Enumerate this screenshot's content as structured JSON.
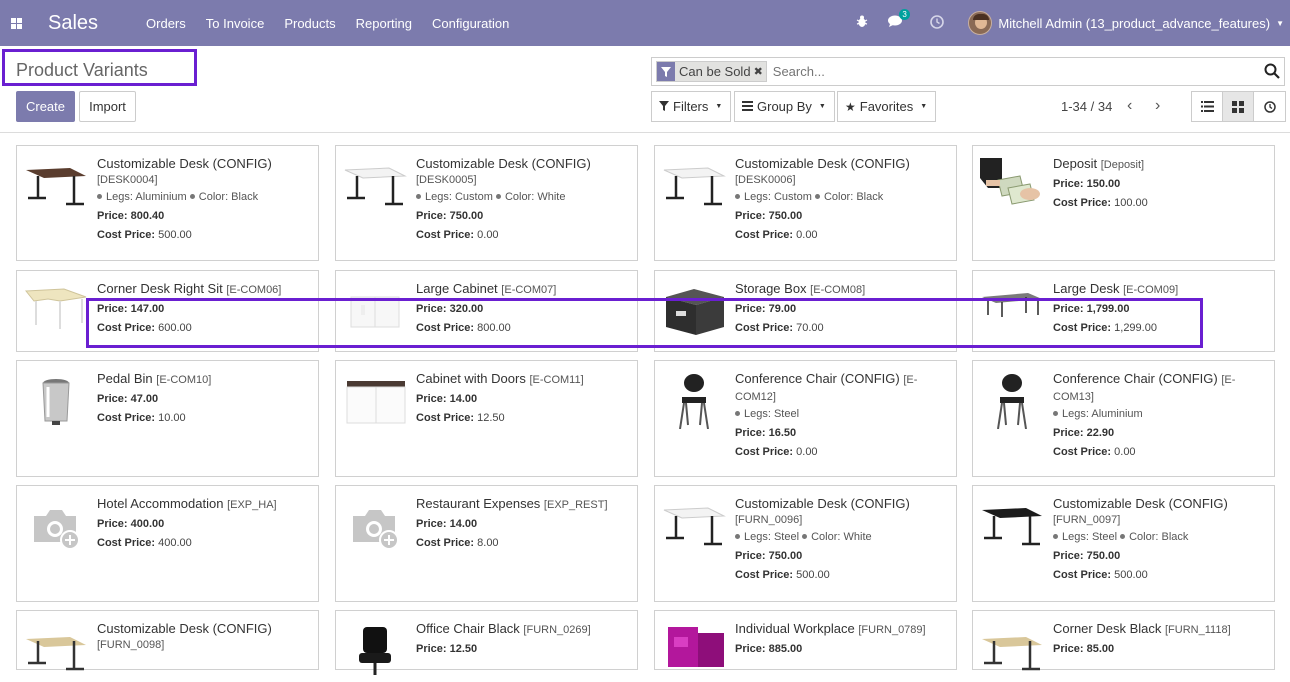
{
  "navbar": {
    "brand": "Sales",
    "menu": [
      "Orders",
      "To Invoice",
      "Products",
      "Reporting",
      "Configuration"
    ],
    "message_count": "3",
    "user": "Mitchell Admin (13_product_advance_features)",
    "bg_color": "#7c7bad"
  },
  "control_panel": {
    "title": "Product Variants",
    "create_label": "Create",
    "import_label": "Import",
    "facet_label": "Can be Sold",
    "search_placeholder": "Search...",
    "filters_label": "Filters",
    "groupby_label": "Group By",
    "favorites_label": "Favorites",
    "pager": "1-34 / 34",
    "highlight_color": "#6a1fd1"
  },
  "cards": [
    {
      "name": "Customizable Desk (CONFIG)",
      "ref": "[DESK0004]",
      "attrs": [
        "Legs: Aluminium",
        "Color: Black"
      ],
      "price": "800.40",
      "cost": "500.00",
      "img": "desk-brown"
    },
    {
      "name": "Customizable Desk (CONFIG)",
      "ref": "[DESK0005]",
      "attrs": [
        "Legs: Custom",
        "Color: White"
      ],
      "price": "750.00",
      "cost": "0.00",
      "img": "desk-white"
    },
    {
      "name": "Customizable Desk (CONFIG)",
      "ref": "[DESK0006]",
      "attrs": [
        "Legs: Custom",
        "Color: Black"
      ],
      "price": "750.00",
      "cost": "0.00",
      "img": "desk-white"
    },
    {
      "name": "Deposit",
      "ref": "[Deposit]",
      "attrs": [],
      "price": "150.00",
      "cost": "100.00",
      "img": "money"
    },
    {
      "name": "Corner Desk Right Sit",
      "ref": "[E-COM06]",
      "attrs": [],
      "price": "147.00",
      "cost": "600.00",
      "img": "corner-desk"
    },
    {
      "name": "Large Cabinet",
      "ref": "[E-COM07]",
      "attrs": [],
      "price": "320.00",
      "cost": "800.00",
      "img": "cabinet"
    },
    {
      "name": "Storage Box",
      "ref": "[E-COM08]",
      "attrs": [],
      "price": "79.00",
      "cost": "70.00",
      "img": "box"
    },
    {
      "name": "Large Desk",
      "ref": "[E-COM09]",
      "attrs": [],
      "price": "1,799.00",
      "cost": "1,299.00",
      "img": "large-desk"
    },
    {
      "name": "Pedal Bin",
      "ref": "[E-COM10]",
      "attrs": [],
      "price": "47.00",
      "cost": "10.00",
      "img": "bin"
    },
    {
      "name": "Cabinet with Doors",
      "ref": "[E-COM11]",
      "attrs": [],
      "price": "14.00",
      "cost": "12.50",
      "img": "cabinet-doors"
    },
    {
      "name": "Conference Chair (CONFIG)",
      "ref": "[E-COM12]",
      "attrs": [
        "Legs: Steel"
      ],
      "price": "16.50",
      "cost": "0.00",
      "img": "chair"
    },
    {
      "name": "Conference Chair (CONFIG)",
      "ref": "[E-COM13]",
      "attrs": [
        "Legs: Aluminium"
      ],
      "price": "22.90",
      "cost": "0.00",
      "img": "chair"
    },
    {
      "name": "Hotel Accommodation",
      "ref": "[EXP_HA]",
      "attrs": [],
      "price": "400.00",
      "cost": "400.00",
      "img": "placeholder"
    },
    {
      "name": "Restaurant Expenses",
      "ref": "[EXP_REST]",
      "attrs": [],
      "price": "14.00",
      "cost": "8.00",
      "img": "placeholder"
    },
    {
      "name": "Customizable Desk (CONFIG)",
      "ref": "[FURN_0096]",
      "attrs": [
        "Legs: Steel",
        "Color: White"
      ],
      "price": "750.00",
      "cost": "500.00",
      "img": "desk-white"
    },
    {
      "name": "Customizable Desk (CONFIG)",
      "ref": "[FURN_0097]",
      "attrs": [
        "Legs: Steel",
        "Color: Black"
      ],
      "price": "750.00",
      "cost": "500.00",
      "img": "desk-black"
    },
    {
      "name": "Customizable Desk (CONFIG)",
      "ref": "[FURN_0098]",
      "attrs": [],
      "price": "",
      "cost": "",
      "img": "desk-wood"
    },
    {
      "name": "Office Chair Black",
      "ref": "[FURN_0269]",
      "attrs": [],
      "price": "12.50",
      "cost": "",
      "img": "office-chair"
    },
    {
      "name": "Individual Workplace",
      "ref": "[FURN_0789]",
      "attrs": [],
      "price": "885.00",
      "cost": "",
      "img": "workplace"
    },
    {
      "name": "Corner Desk Black",
      "ref": "[FURN_1118]",
      "attrs": [],
      "price": "85.00",
      "cost": "",
      "img": "desk-wood"
    }
  ],
  "labels": {
    "price": "Price:",
    "cost": "Cost Price:"
  }
}
